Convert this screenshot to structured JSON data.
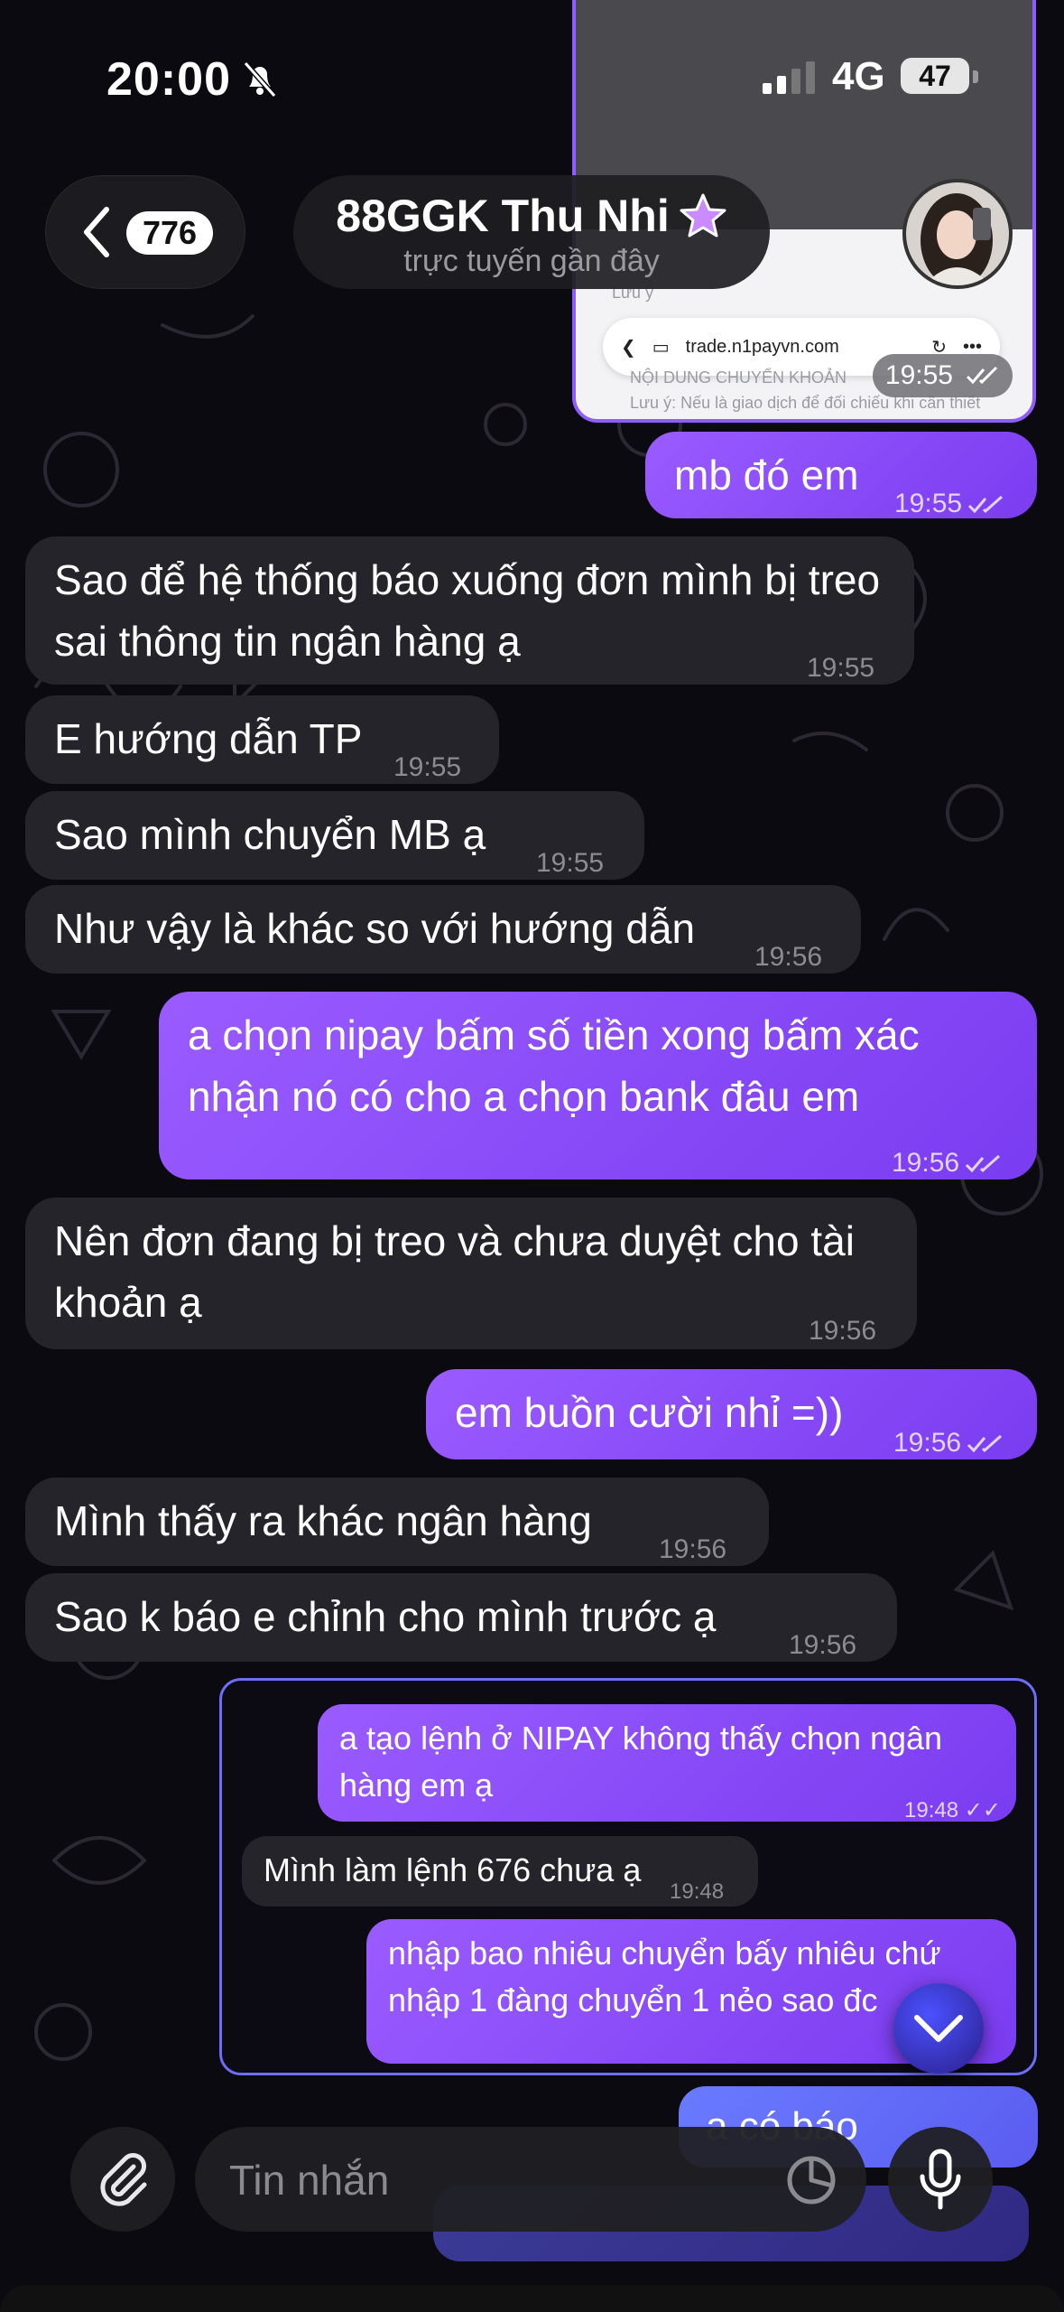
{
  "status_bar": {
    "time": "20:00",
    "network": "4G",
    "battery": "47"
  },
  "header": {
    "back_count": "776",
    "contact_name": "88GGK Thu Nhi",
    "presence": "trực tuyến gần đây"
  },
  "media_preview": {
    "url": "trade.n1payvn.com",
    "time": "19:55",
    "faint_label_1": "Lưu ý",
    "faint_label_2": "NỘI DUNG CHUYỂN KHOẢN",
    "faint_label_3": "Lưu ý: Nếu là giao dịch để đối chiếu khi cần thiết"
  },
  "messages": [
    {
      "dir": "out",
      "text": "mb đó em",
      "time": "19:55"
    },
    {
      "dir": "in",
      "text": "Sao để hệ thống báo xuống đơn mình bị treo sai thông tin ngân hàng ạ",
      "time": "19:55"
    },
    {
      "dir": "in",
      "text": "E hướng dẫn TP",
      "time": "19:55"
    },
    {
      "dir": "in",
      "text": "Sao mình chuyển MB ạ",
      "time": "19:55"
    },
    {
      "dir": "in",
      "text": "Như vậy là khác so với hướng dẫn",
      "time": "19:56"
    },
    {
      "dir": "out",
      "text": "a chọn nipay bấm số tiền xong bấm xác nhận nó có cho a chọn bank đâu em",
      "time": "19:56"
    },
    {
      "dir": "in",
      "text": "Nên đơn đang bị treo và chưa duyệt cho tài khoản ạ",
      "time": "19:56"
    },
    {
      "dir": "out",
      "text": "em buồn cười nhỉ =))",
      "time": "19:56"
    },
    {
      "dir": "in",
      "text": "Mình thấy ra khác ngân hàng",
      "time": "19:56"
    },
    {
      "dir": "in",
      "text": "Sao k báo e chỉnh cho mình trước ạ",
      "time": "19:56"
    }
  ],
  "forwarded": [
    {
      "dir": "out",
      "text": "a tạo lệnh ở NIPAY không thấy chọn ngân hàng em ạ",
      "time": "19:48"
    },
    {
      "dir": "in",
      "text": "Mình làm lệnh 676 chưa ạ",
      "time": "19:48"
    },
    {
      "dir": "out",
      "text": "nhập bao nhiêu chuyển bấy nhiêu chứ nhập 1 đàng chuyển 1 nẻo sao đc"
    }
  ],
  "peek": {
    "text": "a có báo"
  },
  "composer": {
    "placeholder": "Tin nhắn"
  }
}
